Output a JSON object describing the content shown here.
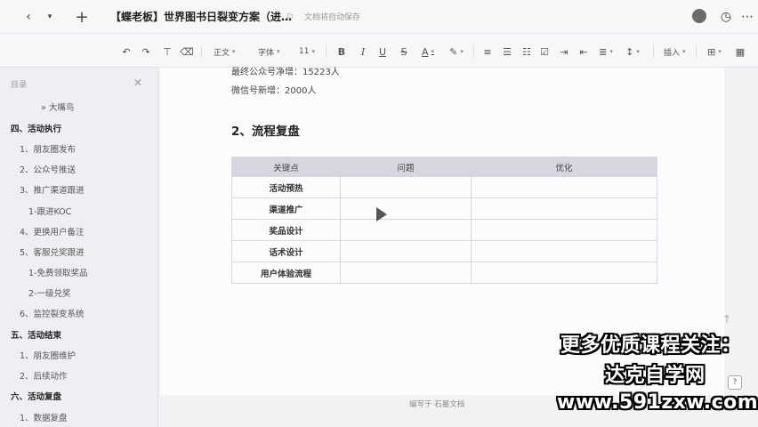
{
  "topbar": {
    "back_icon": "chevron-left-icon",
    "menu_icon": "chevron-down-icon",
    "new_icon": "plus-icon",
    "title": "【蝶老板】世界图书日裂变方案（进…",
    "save_status": "文档将自动保存",
    "history_icon": "history-icon",
    "more_icon": "more-icon"
  },
  "toolbar": {
    "undo_icon": "undo-icon",
    "redo_icon": "redo-icon",
    "paint_icon": "format-painter-icon",
    "clear_icon": "eraser-icon",
    "style": "正文",
    "font": "字体",
    "size": "11",
    "insert": "插入"
  },
  "sidebar": {
    "heading": "目录",
    "items": [
      {
        "label": "» 大嘴鸟",
        "level": 3
      },
      {
        "label": "四、活动执行",
        "level": 1
      },
      {
        "label": "1、朋友圈发布",
        "level": 2
      },
      {
        "label": "2、公众号推送",
        "level": 2
      },
      {
        "label": "3、推广渠道跟进",
        "level": 2
      },
      {
        "label": "1-跟进KOC",
        "level": 3
      },
      {
        "label": "4、更换用户备注",
        "level": 2
      },
      {
        "label": "5、客服兑奖跟进",
        "level": 2
      },
      {
        "label": "1-免费领取奖品",
        "level": 3
      },
      {
        "label": "2-一级兑奖",
        "level": 3
      },
      {
        "label": "6、监控裂变系统",
        "level": 2
      },
      {
        "label": "五、活动结束",
        "level": 1
      },
      {
        "label": "1、朋友圈维护",
        "level": 2
      },
      {
        "label": "2、后续动作",
        "level": 2
      },
      {
        "label": "六、活动复盘",
        "level": 1
      },
      {
        "label": "1、数据复盘",
        "level": 2
      }
    ]
  },
  "doc": {
    "line1": "最终公众号净增：15223人",
    "line2": "微信号新增：2000人",
    "heading": "2、流程复盘",
    "table": {
      "headers": [
        "关键点",
        "问题",
        "优化"
      ],
      "rows": [
        [
          "活动预热",
          "",
          ""
        ],
        [
          "渠道推广",
          "",
          ""
        ],
        [
          "奖品设计",
          "",
          ""
        ],
        [
          "话术设计",
          "",
          ""
        ],
        [
          "用户体验流程",
          "",
          ""
        ]
      ]
    },
    "footer": "编写于 石墨文档"
  },
  "watermark": {
    "line1": "更多优质课程关注：",
    "line2": "达克自学网",
    "line3": "www.591zxw.com"
  },
  "help_label": "?"
}
